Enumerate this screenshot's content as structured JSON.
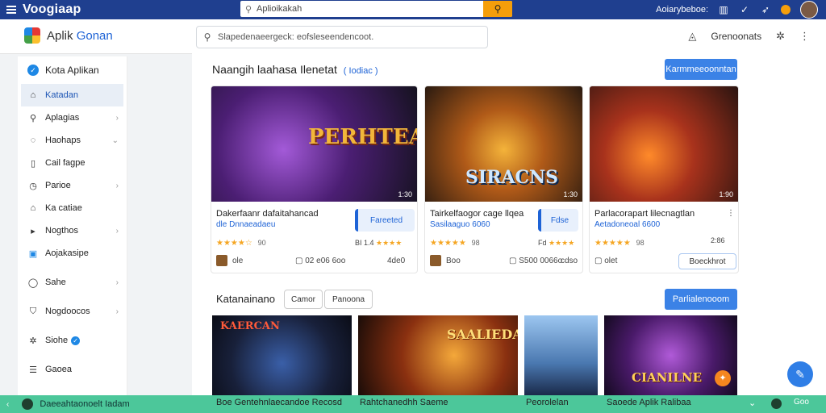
{
  "topbar": {
    "brand": "Voogiaap",
    "search_placeholder": "Aplioikakah",
    "user_label": "Aoiarybeboe:"
  },
  "appbar": {
    "title_prefix": "Aplik",
    "title_suffix": "Gonan",
    "search_placeholder": "Slapedenaeergeck: eofsleseendencoot.",
    "right_label": "Grenoonats"
  },
  "sidebar": {
    "header": "Kota Aplikan",
    "items": [
      {
        "label": "Katadan",
        "icon": "home-icon",
        "active": true
      },
      {
        "label": "Aplagias",
        "icon": "search-icon",
        "chev": "›"
      },
      {
        "label": "Haohaps",
        "icon": "chat-icon",
        "chev": "⌄"
      },
      {
        "label": "Cail fagpe",
        "icon": "file-icon",
        "chev": ""
      },
      {
        "label": "Parioe",
        "icon": "clock-icon",
        "chev": "›"
      },
      {
        "label": "Ka catiae",
        "icon": "house-icon",
        "chev": ""
      },
      {
        "label": "Nogthos",
        "icon": "play-icon",
        "chev": "›"
      },
      {
        "label": "Aojakasipe",
        "icon": "app-icon",
        "chev": ""
      },
      {
        "label": "Sahe",
        "icon": "circle-icon",
        "chev": "›"
      },
      {
        "label": "Nogdoocos",
        "icon": "shield-icon",
        "chev": "›"
      },
      {
        "label": "Siohe",
        "icon": "gear-icon",
        "chev": ""
      },
      {
        "label": "Gaoea",
        "icon": "list-icon",
        "chev": ""
      }
    ]
  },
  "section1": {
    "title": "Naangih laahasa Ilenetat",
    "subtitle": "( Iodiac )",
    "button": "Karmmeeoonntan"
  },
  "cards": [
    {
      "art": "PERHTEAL",
      "badge": "1:30",
      "name": "Dakerfaanr dafaitahancad",
      "dev": "dle Dnnaeadaeu",
      "stars": "★★★★☆",
      "rating": "90",
      "pill": "Fareeted",
      "size_a": "BI 1.4",
      "stars_b": "★★★★",
      "author": "ole",
      "meta": "02 e06 6oo",
      "dl": "4de0"
    },
    {
      "art": "SIRACNS",
      "badge": "1:30",
      "name": "Tairkelfaogor cage llqea",
      "dev": "Sasilaaguo 6060",
      "stars": "★★★★★",
      "rating": "98",
      "pill": "Fdse",
      "size_a": "Fd",
      "stars_b": "★★★★",
      "author": "Boo",
      "meta": "S500 0066o",
      "dl": "cdso"
    },
    {
      "art": "",
      "badge": "1:90",
      "name": "Parlacorapart lilecnagtlan",
      "dev": "Aetadoneoal 6600",
      "stars": "★★★★★",
      "rating": "98",
      "pill": "Boeckhrot",
      "size_a": "2:86",
      "stars_b": "",
      "author": "olet",
      "meta": "",
      "dl": ""
    }
  ],
  "section2": {
    "title": "Katanainano",
    "chip1": "Camor",
    "chip2": "Panoona",
    "button": "Parlialenooom",
    "tiles": [
      {
        "art": "KAERCAN",
        "label": "Boe Gentehnlaecandoe Recosd"
      },
      {
        "art": "SAALIEDA",
        "label": "Rahtchanedhh Saeme"
      },
      {
        "art": "",
        "label": "Peorolelan"
      },
      {
        "art": "CIANILNE",
        "label": "Saoede Aplik Ralibaa"
      }
    ]
  },
  "bottombar": {
    "label": "Daeeahtaonoelt Iadam",
    "right": "Goo"
  },
  "colors": {
    "topbar": "#1f3f8f",
    "accent": "#3b82e6",
    "bottombar": "#4cc79a",
    "search_button": "#f59e0b",
    "star": "#f5a623"
  }
}
